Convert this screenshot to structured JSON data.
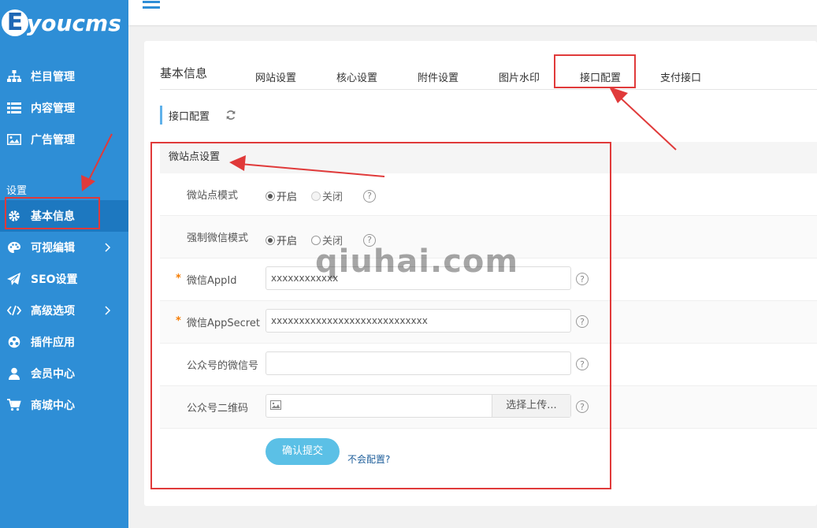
{
  "brand": {
    "logo_letter": "E",
    "logo_text": "youcms",
    "accent": "#2e8ed6"
  },
  "sidebar": {
    "items_top": [
      {
        "label": "栏目管理",
        "icon": "sitemap-icon"
      },
      {
        "label": "内容管理",
        "icon": "list-icon"
      },
      {
        "label": "广告管理",
        "icon": "image-icon"
      }
    ],
    "section_label": "设置",
    "items_settings": [
      {
        "label": "基本信息",
        "icon": "gear-icon",
        "active": true
      },
      {
        "label": "可视编辑",
        "icon": "palette-icon",
        "has_children": true
      },
      {
        "label": "SEO设置",
        "icon": "paper-plane-icon"
      },
      {
        "label": "高级选项",
        "icon": "code-icon",
        "has_children": true
      },
      {
        "label": "插件应用",
        "icon": "plugin-icon"
      },
      {
        "label": "会员中心",
        "icon": "user-icon"
      },
      {
        "label": "商城中心",
        "icon": "cart-icon"
      }
    ]
  },
  "page": {
    "title": "基本信息",
    "tabs": [
      "网站设置",
      "核心设置",
      "附件设置",
      "图片水印",
      "接口配置",
      "支付接口"
    ],
    "active_tab": "接口配置",
    "sub_title": "接口配置"
  },
  "form": {
    "group_title": "微站点设置",
    "microsite_mode": {
      "label": "微站点模式",
      "options": [
        "开启",
        "关闭"
      ],
      "selected": "开启"
    },
    "force_wechat_mode": {
      "label": "强制微信模式",
      "options": [
        "开启",
        "关闭"
      ],
      "selected": "开启"
    },
    "app_id": {
      "label": "微信AppId",
      "required": "*",
      "value": "xxxxxxxxxxxx"
    },
    "app_secret": {
      "label": "微信AppSecret",
      "required": "*",
      "value": "xxxxxxxxxxxxxxxxxxxxxxxxxxxx"
    },
    "wechat_account": {
      "label": "公众号的微信号",
      "value": ""
    },
    "qrcode": {
      "label": "公众号二维码",
      "button": "选择上传..."
    },
    "help_glyph": "?",
    "submit_label": "确认提交",
    "help_link": "不会配置?"
  },
  "watermark": "qiuhai.com",
  "colors": {
    "annotation_red": "#e03a3a",
    "submit": "#5bc0e6",
    "sidebar_active": "#1d78c0"
  }
}
